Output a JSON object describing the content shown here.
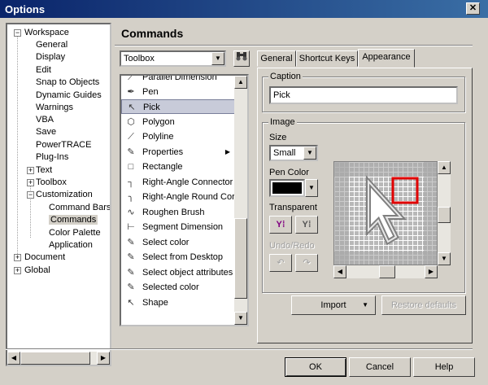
{
  "window": {
    "title": "Options",
    "close_glyph": "✕"
  },
  "tree": {
    "items": [
      {
        "label": "Workspace",
        "expander": "−"
      },
      {
        "label": "General"
      },
      {
        "label": "Display"
      },
      {
        "label": "Edit"
      },
      {
        "label": "Snap to Objects"
      },
      {
        "label": "Dynamic Guides"
      },
      {
        "label": "Warnings"
      },
      {
        "label": "VBA"
      },
      {
        "label": "Save"
      },
      {
        "label": "PowerTRACE"
      },
      {
        "label": "Plug-Ins"
      },
      {
        "label": "Text",
        "expander": "+"
      },
      {
        "label": "Toolbox",
        "expander": "+"
      },
      {
        "label": "Customization",
        "expander": "−"
      },
      {
        "label": "Command Bars"
      },
      {
        "label": "Commands"
      },
      {
        "label": "Color Palette"
      },
      {
        "label": "Application"
      },
      {
        "label": "Document",
        "expander": "+"
      },
      {
        "label": "Global",
        "expander": "+"
      }
    ]
  },
  "panel": {
    "heading": "Commands",
    "category_select": "Toolbox",
    "commands": [
      {
        "label": "Parallel Dimension",
        "icon": "parallel-dimension-icon",
        "glyph": "⟋"
      },
      {
        "label": "Pen",
        "icon": "pen-icon",
        "glyph": "✒"
      },
      {
        "label": "Pick",
        "icon": "pick-arrow-icon",
        "glyph": "↖"
      },
      {
        "label": "Polygon",
        "icon": "polygon-icon",
        "glyph": "⬡"
      },
      {
        "label": "Polyline",
        "icon": "polyline-icon",
        "glyph": "⟋"
      },
      {
        "label": "Properties",
        "icon": "properties-icon",
        "glyph": "✎",
        "submenu": true
      },
      {
        "label": "Rectangle",
        "icon": "rectangle-icon",
        "glyph": "□"
      },
      {
        "label": "Right-Angle Connector",
        "icon": "right-angle-connector-icon",
        "glyph": "┐"
      },
      {
        "label": "Right-Angle Round Corner Connector",
        "icon": "round-corner-connector-icon",
        "glyph": "╮"
      },
      {
        "label": "Roughen Brush",
        "icon": "roughen-brush-icon",
        "glyph": "∿"
      },
      {
        "label": "Segment Dimension",
        "icon": "segment-dimension-icon",
        "glyph": "⊢"
      },
      {
        "label": "Select color",
        "icon": "eyedropper-icon",
        "glyph": "✎"
      },
      {
        "label": "Select from Desktop",
        "icon": "eyedropper-icon",
        "glyph": "✎"
      },
      {
        "label": "Select object attributes",
        "icon": "eyedropper-icon",
        "glyph": "✎"
      },
      {
        "label": "Selected color",
        "icon": "eyedropper-icon",
        "glyph": "✎"
      },
      {
        "label": "Shape",
        "icon": "shape-tool-icon",
        "glyph": "↖"
      }
    ]
  },
  "tabs": [
    {
      "label": "General"
    },
    {
      "label": "Shortcut Keys"
    },
    {
      "label": "Appearance"
    }
  ],
  "appearance": {
    "caption_group": "Caption",
    "caption_value": "Pick",
    "image_group": "Image",
    "size_label": "Size",
    "size_value": "Small",
    "pen_color_label": "Pen Color",
    "pen_color": "#000000",
    "transparent_label": "Transparent",
    "undo_redo_label": "Undo/Redo",
    "import_label": "Import",
    "restore_label": "Restore defaults"
  },
  "footer": {
    "ok": "OK",
    "cancel": "Cancel",
    "help": "Help"
  },
  "colors": {
    "titlebar": "#0a246a",
    "selection": "#c8cbd9",
    "highlight_box": "#e00000"
  }
}
